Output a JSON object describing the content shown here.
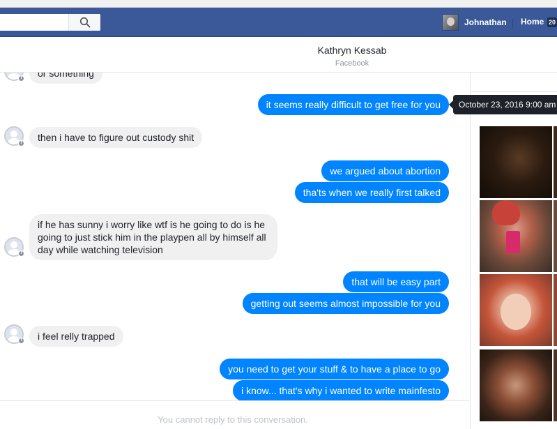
{
  "topbar": {
    "search_placeholder": "",
    "user_name": "Johnathan",
    "home_label": "Home",
    "home_badge": "20"
  },
  "conversation": {
    "name": "Kathryn Kessab",
    "subtitle": "Facebook",
    "tooltip": "October 23, 2016 9:00 am",
    "messages": [
      {
        "from": "them",
        "text": "or something"
      },
      {
        "from": "me",
        "text": "it seems really difficult to get free for you"
      },
      {
        "from": "them",
        "text": "then i have to figure out custody shit"
      },
      {
        "from": "me",
        "text": "we argued about abortion"
      },
      {
        "from": "me",
        "text": "tha'ts when we really first talked"
      },
      {
        "from": "them",
        "text": "if he has sunny i worry like wtf is he going to do is he going to just stick him in the playpen all by himself all day while watching television"
      },
      {
        "from": "me",
        "text": "that will be easy part"
      },
      {
        "from": "me",
        "text": "getting out seems almost impossible for you"
      },
      {
        "from": "them",
        "text": "i feel relly trapped"
      },
      {
        "from": "me",
        "text": "you need to get your stuff & to have a place to go"
      },
      {
        "from": "me",
        "text": "i know... that's why i wanted to write mainfesto"
      }
    ],
    "reply_notice": "You cannot reply to this conversation."
  },
  "colors": {
    "brand": "#3b5998",
    "outgoing_bubble": "#0084ff",
    "incoming_bubble": "#f1f0f0"
  }
}
